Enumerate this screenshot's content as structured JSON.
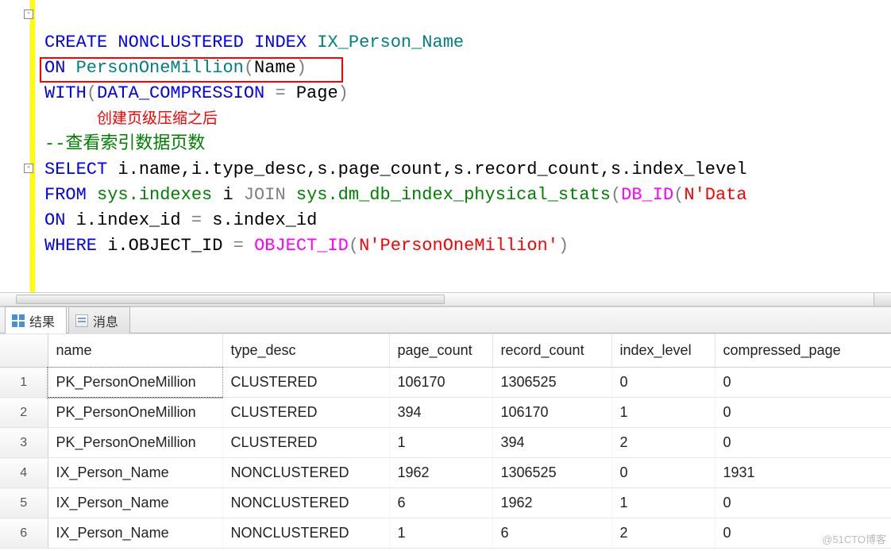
{
  "sql": {
    "line1": {
      "kw1": "CREATE",
      "kw2": "NONCLUSTERED",
      "kw3": "INDEX",
      "idx": "IX_Person_Name"
    },
    "line2": {
      "kw": "ON",
      "obj": "PersonOneMillion",
      "paren_open": "(",
      "col": "Name",
      "paren_close": ")"
    },
    "line3": {
      "kw": "WITH",
      "paren_open": "(",
      "opt": "DATA_COMPRESSION",
      "eq": " = ",
      "val": "Page",
      "paren_close": ")"
    },
    "annotation": "创建页级压缩之后",
    "comment": "--查看索引数据页数",
    "line6": {
      "kw": "SELECT",
      "body": " i.name,i.type_desc,s.page_count,s.record_count,s.index_level"
    },
    "line7": {
      "kw1": "FROM",
      "obj1": "sys.indexes",
      "alias1": " i ",
      "kw2": "JOIN",
      "obj2": "sys.dm_db_index_physical_stats",
      "paren_open": "(",
      "fn": "DB_ID",
      "paren2": "(",
      "n": "N",
      "str": "'Data",
      "trail": ""
    },
    "line8": {
      "kw": "ON",
      "body": " i.index_id ",
      "eq": "=",
      "body2": " s.index_id"
    },
    "line9": {
      "kw": "WHERE",
      "body": " i.OBJECT_ID ",
      "eq": "=",
      "space": " ",
      "fn": "OBJECT_ID",
      "paren_open": "(",
      "n": "N",
      "str": "'PersonOneMillion'",
      "paren_close": ")"
    }
  },
  "tabs": {
    "results": "结果",
    "messages": "消息"
  },
  "columns": {
    "name": "name",
    "type_desc": "type_desc",
    "page_count": "page_count",
    "record_count": "record_count",
    "index_level": "index_level",
    "compressed_page": "compressed_page"
  },
  "rows": [
    {
      "n": "1",
      "name": "PK_PersonOneMillion",
      "type_desc": "CLUSTERED",
      "page_count": "106170",
      "record_count": "1306525",
      "index_level": "0",
      "compressed_page": "0"
    },
    {
      "n": "2",
      "name": "PK_PersonOneMillion",
      "type_desc": "CLUSTERED",
      "page_count": "394",
      "record_count": "106170",
      "index_level": "1",
      "compressed_page": "0"
    },
    {
      "n": "3",
      "name": "PK_PersonOneMillion",
      "type_desc": "CLUSTERED",
      "page_count": "1",
      "record_count": "394",
      "index_level": "2",
      "compressed_page": "0"
    },
    {
      "n": "4",
      "name": "IX_Person_Name",
      "type_desc": "NONCLUSTERED",
      "page_count": "1962",
      "record_count": "1306525",
      "index_level": "0",
      "compressed_page": "1931"
    },
    {
      "n": "5",
      "name": "IX_Person_Name",
      "type_desc": "NONCLUSTERED",
      "page_count": "6",
      "record_count": "1962",
      "index_level": "1",
      "compressed_page": "0"
    },
    {
      "n": "6",
      "name": "IX_Person_Name",
      "type_desc": "NONCLUSTERED",
      "page_count": "1",
      "record_count": "6",
      "index_level": "2",
      "compressed_page": "0"
    }
  ],
  "watermark": "@51CTO博客"
}
